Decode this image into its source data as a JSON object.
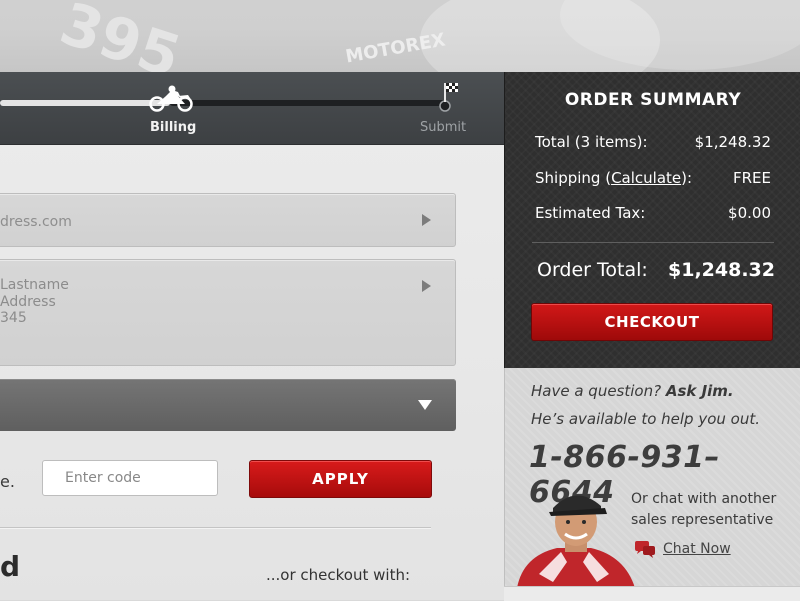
{
  "progress": {
    "steps": [
      {
        "label": "Billing"
      },
      {
        "label": "Submit"
      }
    ]
  },
  "form": {
    "email_value": "dress.com",
    "address_lines": [
      "Lastname",
      "Address",
      "345"
    ],
    "promo_label": "e.",
    "promo_placeholder": "Enter code",
    "apply_label": "APPLY",
    "section_heading_partial": "d",
    "checkout_with_label": "...or checkout with:"
  },
  "summary": {
    "title": "ORDER SUMMARY",
    "total_items_label": "Total (3 items):",
    "total_items_value": "$1,248.32",
    "shipping_label_prefix": "Shipping (",
    "shipping_link": "Calculate",
    "shipping_label_suffix": "):",
    "shipping_value": "FREE",
    "tax_label": "Estimated Tax:",
    "tax_value": "$0.00",
    "order_total_label": "Order Total:",
    "order_total_value": "$1,248.32",
    "checkout_label": "CHECKOUT"
  },
  "help": {
    "question_prefix": "Have a question? ",
    "question_bold": "Ask Jim.",
    "subtext": "He’s available to help you out.",
    "phone": "1-866-931–6644",
    "chat_text": "Or chat with another sales representative",
    "chat_link": "Chat Now"
  },
  "banner": {
    "texts": [
      "395",
      "MOTOREX"
    ]
  },
  "colors": {
    "accent_red": "#c41212",
    "summary_bg": "#2f2f2f",
    "progress_bg": "#45494c"
  }
}
